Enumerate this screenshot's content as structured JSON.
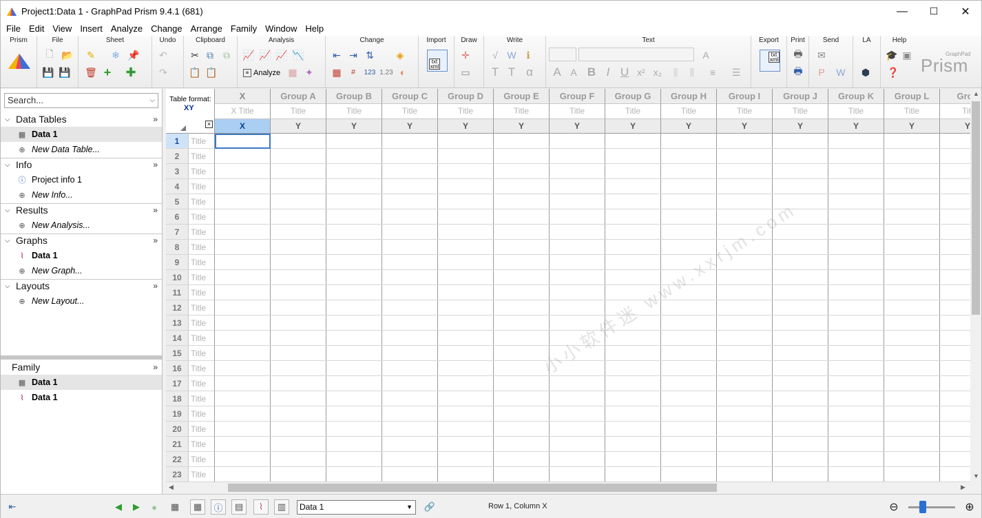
{
  "window": {
    "title": "Project1:Data 1 - GraphPad Prism 9.4.1 (681)",
    "controls": [
      "—",
      "☐",
      "✕"
    ]
  },
  "menu": [
    "File",
    "Edit",
    "View",
    "Insert",
    "Analyze",
    "Change",
    "Arrange",
    "Family",
    "Window",
    "Help"
  ],
  "ribbon": {
    "groups": [
      "Prism",
      "File",
      "Sheet",
      "Undo",
      "Clipboard",
      "Analysis",
      "Change",
      "Import",
      "Draw",
      "Write",
      "Text",
      "Export",
      "Print",
      "Send",
      "LA",
      "Help"
    ],
    "analyze_label": "Analyze",
    "brand": "Prism",
    "brand_small": "GraphPad",
    "import_badge_1": "txt",
    "import_badge_2": "xml"
  },
  "sidebar": {
    "search_placeholder": "Search...",
    "sections": [
      {
        "title": "Data Tables",
        "items": [
          {
            "label": "Data 1",
            "selected": true
          },
          {
            "label": "New Data Table...",
            "new": true
          }
        ]
      },
      {
        "title": "Info",
        "items": [
          {
            "label": "Project info 1"
          },
          {
            "label": "New Info...",
            "new": true
          }
        ]
      },
      {
        "title": "Results",
        "items": [
          {
            "label": "New Analysis...",
            "new": true
          }
        ]
      },
      {
        "title": "Graphs",
        "items": [
          {
            "label": "Data 1"
          },
          {
            "label": "New Graph...",
            "new": true
          }
        ]
      },
      {
        "title": "Layouts",
        "items": [
          {
            "label": "New Layout...",
            "new": true
          }
        ]
      }
    ],
    "family": {
      "title": "Family",
      "items": [
        {
          "label": "Data 1",
          "selected": true
        },
        {
          "label": "Data 1"
        }
      ]
    }
  },
  "table": {
    "format_label": "Table format:",
    "format_value": "XY",
    "columns": [
      {
        "header": "X",
        "title": "X Title",
        "kind": "X"
      },
      {
        "header": "Group A",
        "title": "Title",
        "kind": "Y"
      },
      {
        "header": "Group B",
        "title": "Title",
        "kind": "Y"
      },
      {
        "header": "Group C",
        "title": "Title",
        "kind": "Y"
      },
      {
        "header": "Group D",
        "title": "Title",
        "kind": "Y"
      },
      {
        "header": "Group E",
        "title": "Title",
        "kind": "Y"
      },
      {
        "header": "Group F",
        "title": "Title",
        "kind": "Y"
      },
      {
        "header": "Group G",
        "title": "Title",
        "kind": "Y"
      },
      {
        "header": "Group H",
        "title": "Title",
        "kind": "Y"
      },
      {
        "header": "Group I",
        "title": "Title",
        "kind": "Y"
      },
      {
        "header": "Group J",
        "title": "Title",
        "kind": "Y"
      },
      {
        "header": "Group K",
        "title": "Title",
        "kind": "Y"
      },
      {
        "header": "Group L",
        "title": "Title",
        "kind": "Y"
      },
      {
        "header": "Grou",
        "title": "Titl",
        "kind": "Y"
      }
    ],
    "row_title": "Title",
    "row_count": 23
  },
  "watermark": "小小软件迷 www.xxrjm.com",
  "status": {
    "sheet_selected": "Data 1",
    "position": "Row 1, Column X"
  },
  "colors": {
    "accent": "#2b6fd1",
    "selection": "#aacff3",
    "format_text": "#0b2f9e"
  }
}
